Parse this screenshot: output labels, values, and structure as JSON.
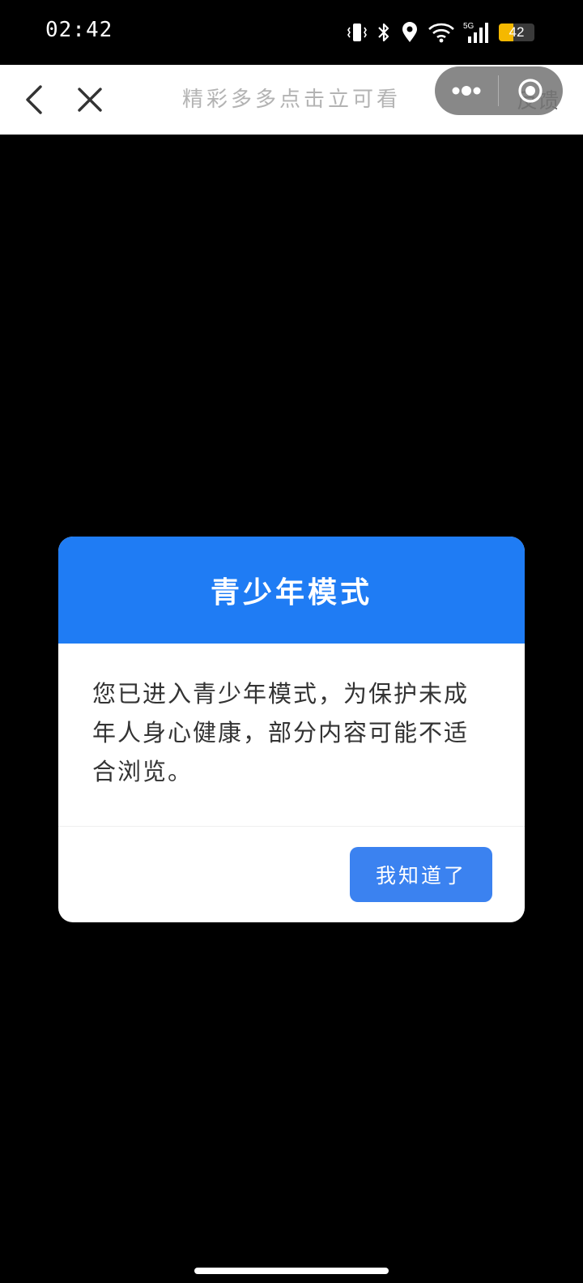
{
  "status_bar": {
    "time": "02:42",
    "network_label": "5G",
    "battery_level": "42",
    "battery_percent": 42,
    "icons": [
      "vibrate-icon",
      "bluetooth-icon",
      "location-icon",
      "wifi-icon",
      "cellular-5g-icon",
      "battery-icon"
    ]
  },
  "nav": {
    "title": "精彩多多点击立可看",
    "feedback_label": "反馈",
    "back_icon": "chevron-left-icon",
    "close_icon": "close-icon",
    "more_icon": "more-dots-icon",
    "exit_icon": "target-circle-icon"
  },
  "dialog": {
    "title": "青少年模式",
    "message": "您已进入青少年模式，为保护未成年人身心健康，部分内容可能不适合浏览。",
    "confirm_label": "我知道了"
  },
  "colors": {
    "header_blue": "#1f7cf4",
    "button_blue": "#3b82f0",
    "battery_yellow": "#f5b800"
  }
}
